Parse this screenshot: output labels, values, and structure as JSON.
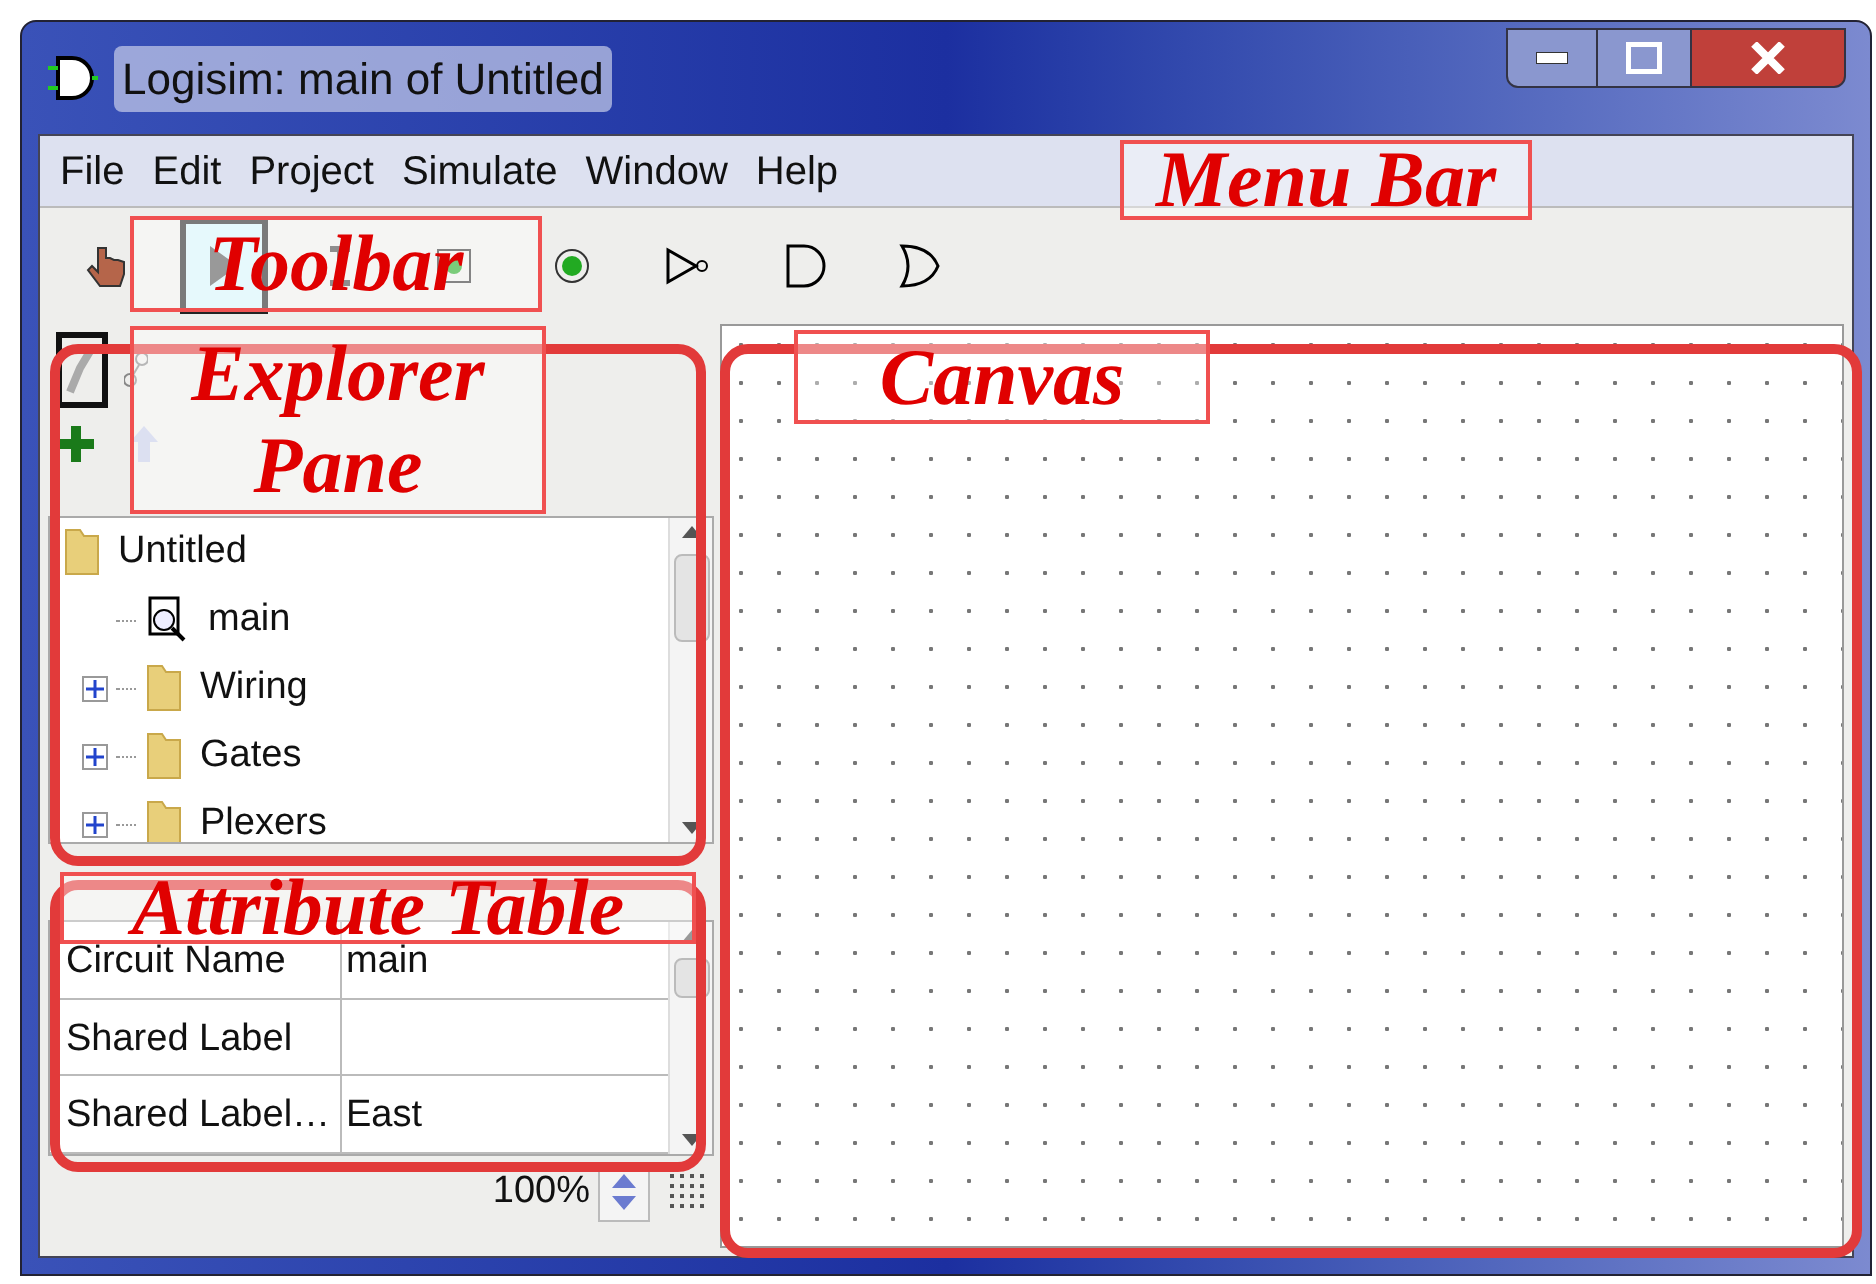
{
  "window": {
    "title": "Logisim: main of Untitled"
  },
  "menu_bar": [
    "File",
    "Edit",
    "Project",
    "Simulate",
    "Window",
    "Help"
  ],
  "tools": [
    {
      "kind": "poke",
      "selected": false
    },
    {
      "kind": "edit",
      "selected": true
    },
    {
      "kind": "text",
      "selected": false
    },
    {
      "kind": "input-pin",
      "selected": false
    },
    {
      "kind": "output-pin",
      "selected": false
    },
    {
      "kind": "not-gate",
      "selected": false
    },
    {
      "kind": "and-gate",
      "selected": false
    },
    {
      "kind": "or-gate",
      "selected": false
    }
  ],
  "explorer": {
    "tree": [
      {
        "label": "Untitled",
        "kind": "project",
        "children": [
          {
            "label": "main",
            "kind": "circuit"
          },
          {
            "label": "Wiring",
            "kind": "library",
            "expanded": false
          },
          {
            "label": "Gates",
            "kind": "library",
            "expanded": false
          },
          {
            "label": "Plexers",
            "kind": "library",
            "expanded": false
          }
        ]
      }
    ]
  },
  "attribute_table": {
    "rows": [
      {
        "name": "Circuit Name",
        "value": "main"
      },
      {
        "name": "Shared Label"
      },
      {
        "name": "Shared Label…",
        "value": "East"
      }
    ]
  },
  "zoom": "100%",
  "annotations": [
    "Menu Bar",
    "Toolbar",
    "Explorer Pane",
    "Canvas",
    "Attribute Table"
  ]
}
